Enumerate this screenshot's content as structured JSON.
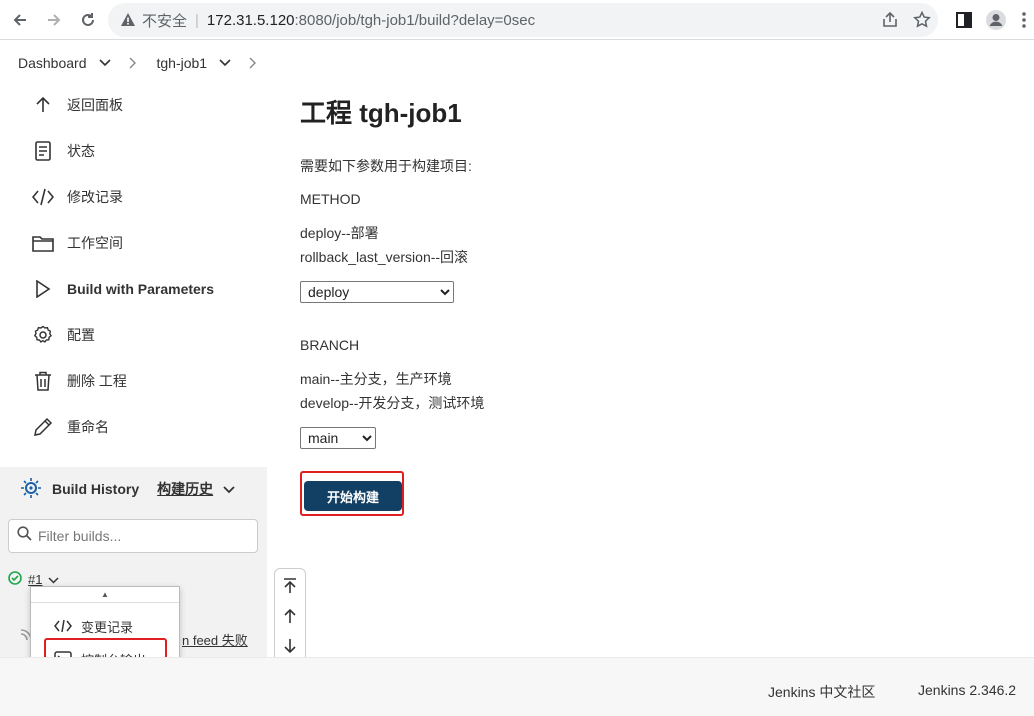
{
  "browser": {
    "insecure_label": "不安全",
    "url_host": "172.31.5.120",
    "url_path": ":8080/job/tgh-job1/build?delay=0sec"
  },
  "breadcrumb": {
    "items": [
      {
        "label": "Dashboard"
      },
      {
        "label": "tgh-job1"
      }
    ]
  },
  "sidebar": {
    "items": [
      {
        "label": "返回面板",
        "icon": "arrow-up-icon"
      },
      {
        "label": "状态",
        "icon": "document-icon"
      },
      {
        "label": "修改记录",
        "icon": "code-icon"
      },
      {
        "label": "工作空间",
        "icon": "folder-icon"
      },
      {
        "label": "Build with Parameters",
        "icon": "play-icon"
      },
      {
        "label": "配置",
        "icon": "gear-icon"
      },
      {
        "label": "删除 工程",
        "icon": "trash-icon"
      },
      {
        "label": "重命名",
        "icon": "pencil-icon"
      }
    ]
  },
  "build_history": {
    "title": "Build History",
    "title_zh": "构建历史",
    "filter_placeholder": "Filter builds...",
    "build_number": "#1",
    "feed_text": "n feed 失败"
  },
  "context_menu": {
    "items": [
      {
        "label": "变更记录",
        "icon": "code-icon"
      },
      {
        "label": "控制台输出",
        "icon": "terminal-icon"
      }
    ]
  },
  "main": {
    "title": "工程 tgh-job1",
    "intro": "需要如下参数用于构建项目:",
    "params": [
      {
        "name": "METHOD",
        "desc_lines": [
          "deploy--部署",
          "rollback_last_version--回滚"
        ],
        "selected": "deploy"
      },
      {
        "name": "BRANCH",
        "desc_lines": [
          "main--主分支，生产环境",
          "develop--开发分支，测试环境"
        ],
        "selected": "main"
      }
    ],
    "build_button": "开始构建"
  },
  "footer": {
    "community": "Jenkins 中文社区",
    "version": "Jenkins 2.346.2"
  },
  "colors": {
    "build_button_bg": "#123f64",
    "highlight": "#e02020",
    "success": "#1ea64b"
  }
}
